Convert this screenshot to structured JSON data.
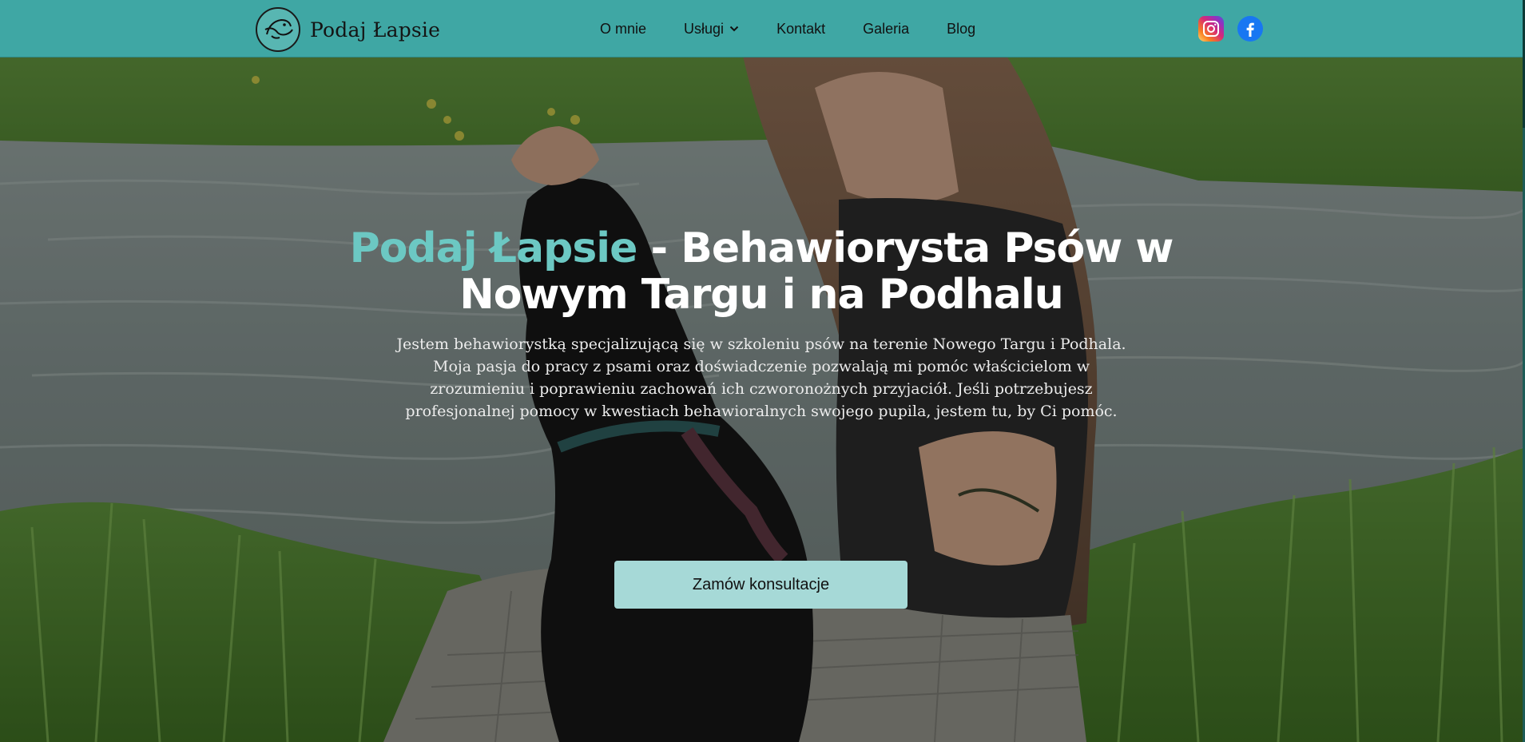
{
  "brand": {
    "name": "Podaj Łapsie",
    "logo_icon": "dog-paw-logo-icon"
  },
  "nav": {
    "items": [
      {
        "label": "O mnie",
        "has_dropdown": false
      },
      {
        "label": "Usługi",
        "has_dropdown": true
      },
      {
        "label": "Kontakt",
        "has_dropdown": false
      },
      {
        "label": "Galeria",
        "has_dropdown": false
      },
      {
        "label": "Blog",
        "has_dropdown": false
      }
    ]
  },
  "social": {
    "instagram_icon": "instagram-icon",
    "facebook_icon": "facebook-icon"
  },
  "hero": {
    "title_accent": "Podaj Łapsie",
    "title_rest": " - Behawiorysta Psów w Nowym Targu i na Podhalu",
    "description": "Jestem behawiorystką specjalizującą się w szkoleniu psów na terenie Nowego Targu i Podhala. Moja pasja do pracy z psami oraz doświadczenie pozwalają mi pomóc właścicielom w zrozumieniu i poprawieniu zachowań ich czworonożnych przyjaciół. Jeśli potrzebujesz profesjonalnej pomocy w kwestiach behawioralnych swojego pupila, jestem tu, by Ci pomóc.",
    "cta_label": "Zamów konsultacje"
  },
  "colors": {
    "navbar_bg": "#3fa7a4",
    "accent": "#6cc8c3",
    "cta_bg": "#a6d9d7"
  }
}
